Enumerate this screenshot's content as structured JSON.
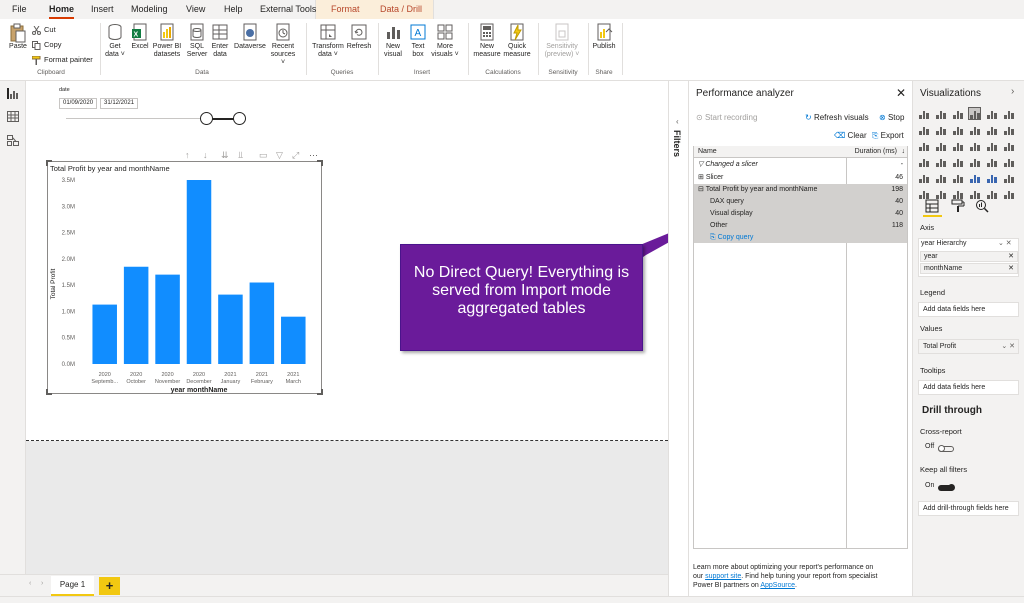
{
  "ribbon": {
    "tabs": [
      "File",
      "Home",
      "Insert",
      "Modeling",
      "View",
      "Help",
      "External Tools",
      "Format",
      "Data / Drill"
    ],
    "clipboard": {
      "paste": "Paste",
      "cut": "Cut",
      "copy": "Copy",
      "format_painter": "Format painter",
      "group": "Clipboard"
    },
    "data": {
      "get_data": [
        "Get",
        "data ˅"
      ],
      "excel": "Excel",
      "power_bi": [
        "Power BI",
        "datasets"
      ],
      "sql": [
        "SQL",
        "Server"
      ],
      "enter_data": [
        "Enter",
        "data"
      ],
      "dataverse": "Dataverse",
      "recent": [
        "Recent",
        "sources ˅"
      ],
      "group": "Data"
    },
    "queries": {
      "transform": [
        "Transform",
        "data ˅"
      ],
      "refresh": "Refresh",
      "group": "Queries"
    },
    "insert": {
      "new_visual": [
        "New",
        "visual"
      ],
      "text_box": [
        "Text",
        "box"
      ],
      "more_visuals": [
        "More",
        "visuals ˅"
      ],
      "group": "Insert"
    },
    "calculations": {
      "new_measure": [
        "New",
        "measure"
      ],
      "quick_measure": [
        "Quick",
        "measure"
      ],
      "group": "Calculations"
    },
    "sensitivity": {
      "label": [
        "Sensitivity",
        "(preview) ˅"
      ],
      "group": "Sensitivity"
    },
    "share": {
      "publish": "Publish",
      "group": "Share"
    }
  },
  "slicer": {
    "title": "date",
    "start": "01/09/2020",
    "end": "31/12/2021"
  },
  "chart_data": {
    "type": "bar",
    "title": "Total Profit by year and monthName",
    "xlabel": "year monthName",
    "ylabel": "Total Profit",
    "categories_year": [
      "2020",
      "2020",
      "2020",
      "2020",
      "2021",
      "2021",
      "2021"
    ],
    "categories": [
      "Septemb...",
      "October",
      "November",
      "December",
      "January",
      "February",
      "March"
    ],
    "values": [
      1.13,
      1.85,
      1.7,
      3.5,
      1.32,
      1.55,
      0.9
    ],
    "yticks": [
      "0.0M",
      "0.5M",
      "1.0M",
      "1.5M",
      "2.0M",
      "2.5M",
      "3.0M",
      "3.5M"
    ],
    "ylim": [
      0,
      3.5
    ],
    "color": "#118dff"
  },
  "callout": {
    "text": "No Direct Query! Everything is served from Import mode aggregated tables"
  },
  "pages": {
    "page1": "Page 1",
    "add": "+"
  },
  "filters": {
    "label": "Filters"
  },
  "performance": {
    "title": "Performance analyzer",
    "start": "Start recording",
    "refresh": "Refresh visuals",
    "stop": "Stop",
    "clear": "Clear",
    "export": "Export",
    "col_name": "Name",
    "col_duration": "Duration (ms)",
    "rows": [
      {
        "name": "Changed a slicer",
        "value": "-"
      },
      {
        "name": "Slicer",
        "value": "46"
      },
      {
        "name": "Total Profit by year and monthName",
        "value": "198"
      },
      {
        "name": "DAX query",
        "value": "40"
      },
      {
        "name": "Visual display",
        "value": "40"
      },
      {
        "name": "Other",
        "value": "118"
      }
    ],
    "copy_query": "Copy query",
    "footer_1": "Learn more about optimizing your report's performance on",
    "footer_our": "our",
    "footer_link1": "support site",
    "footer_2": ". Find help tuning your report from specialist",
    "footer_3": "Power BI partners on",
    "footer_link2": "AppSource",
    "footer_end": "."
  },
  "visualizations": {
    "title": "Visualizations",
    "axis": "Axis",
    "axis_field": "year Hierarchy",
    "axis_sub": [
      "year",
      "monthName"
    ],
    "legend": "Legend",
    "legend_placeholder": "Add data fields here",
    "values": "Values",
    "values_field": "Total Profit",
    "tooltips": "Tooltips",
    "tooltips_placeholder": "Add data fields here",
    "drill_through": "Drill through",
    "cross_report": "Cross-report",
    "cross_report_state": "Off",
    "keep_filters": "Keep all filters",
    "keep_filters_state": "On",
    "drill_placeholder": "Add drill-through fields here"
  }
}
